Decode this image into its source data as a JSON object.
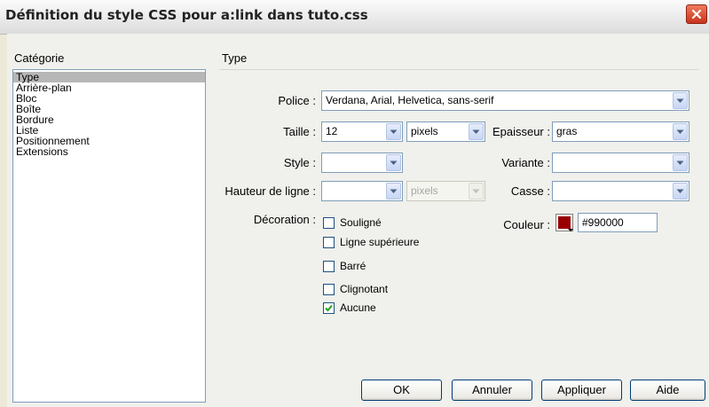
{
  "window": {
    "title": "Définition du style CSS pour a:link dans tuto.css"
  },
  "category": {
    "header": "Catégorie",
    "items": [
      "Type",
      "Arrière-plan",
      "Bloc",
      "Boîte",
      "Bordure",
      "Liste",
      "Positionnement",
      "Extensions"
    ],
    "selected": "Type"
  },
  "panel": {
    "header": "Type"
  },
  "fields": {
    "police_label": "Police :",
    "police_value": "Verdana, Arial, Helvetica, sans-serif",
    "taille_label": "Taille :",
    "taille_value": "12",
    "taille_unit": "pixels",
    "epaisseur_label": "Epaisseur :",
    "epaisseur_value": "gras",
    "style_label": "Style :",
    "style_value": "",
    "variante_label": "Variante :",
    "variante_value": "",
    "hauteur_label": "Hauteur de ligne :",
    "hauteur_value": "",
    "hauteur_unit": "pixels",
    "casse_label": "Casse :",
    "casse_value": "",
    "couleur_label": "Couleur :",
    "couleur_value": "#990000",
    "couleur_swatch": "#990000",
    "decoration_label": "Décoration :"
  },
  "decoration": [
    {
      "label": "Souligné",
      "checked": false
    },
    {
      "label": "Ligne supérieure",
      "checked": false
    },
    {
      "label": "Barré",
      "checked": false
    },
    {
      "label": "Clignotant",
      "checked": false
    },
    {
      "label": "Aucune",
      "checked": true
    }
  ],
  "buttons": {
    "ok": "OK",
    "cancel": "Annuler",
    "apply": "Appliquer",
    "help": "Aide"
  }
}
